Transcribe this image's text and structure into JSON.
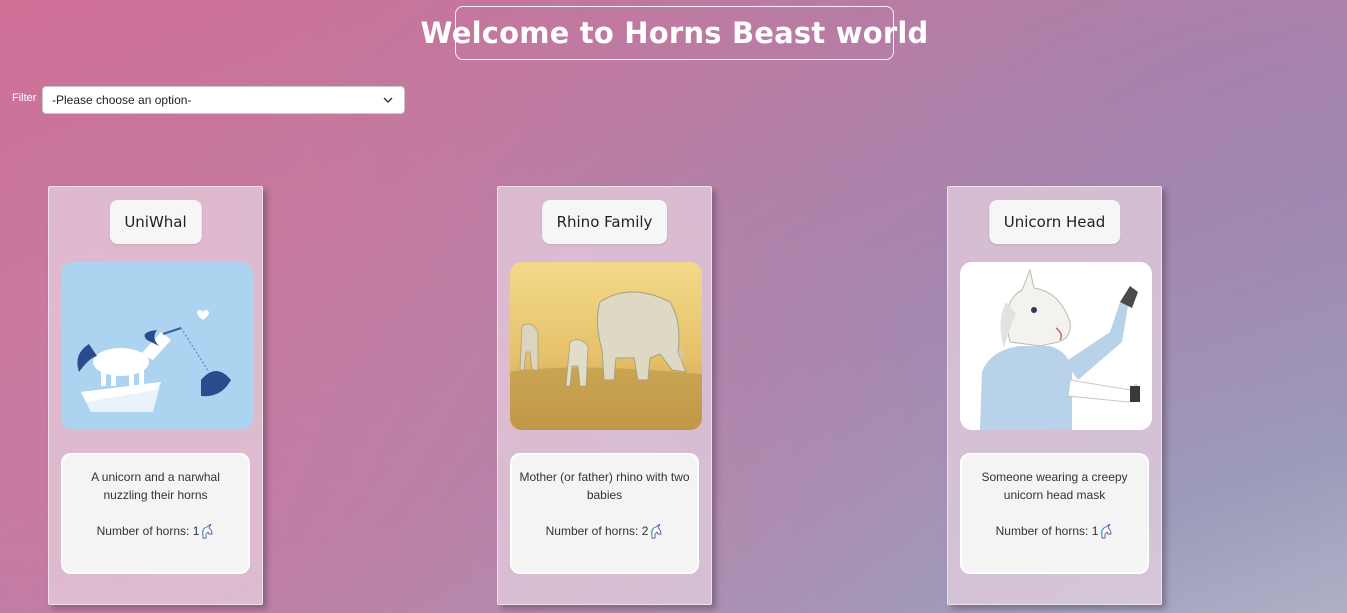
{
  "header": {
    "title": "Welcome to Horns Beast world"
  },
  "filter": {
    "label": "Filter",
    "selected": "-Please choose an option-"
  },
  "cards": [
    {
      "title": "UniWhal",
      "description": "A unicorn and a narwhal nuzzling their horns",
      "horns_label": "Number of horns: ",
      "horns": "1",
      "horn_icon": "unicorn-icon"
    },
    {
      "title": "Rhino Family",
      "description": "Mother (or father) rhino with two babies",
      "horns_label": "Number of horns: ",
      "horns": "2",
      "horn_icon": "unicorn-icon"
    },
    {
      "title": "Unicorn Head",
      "description": "Someone wearing a creepy unicorn head mask",
      "horns_label": "Number of horns: ",
      "horns": "1",
      "horn_icon": "unicorn-icon"
    }
  ]
}
